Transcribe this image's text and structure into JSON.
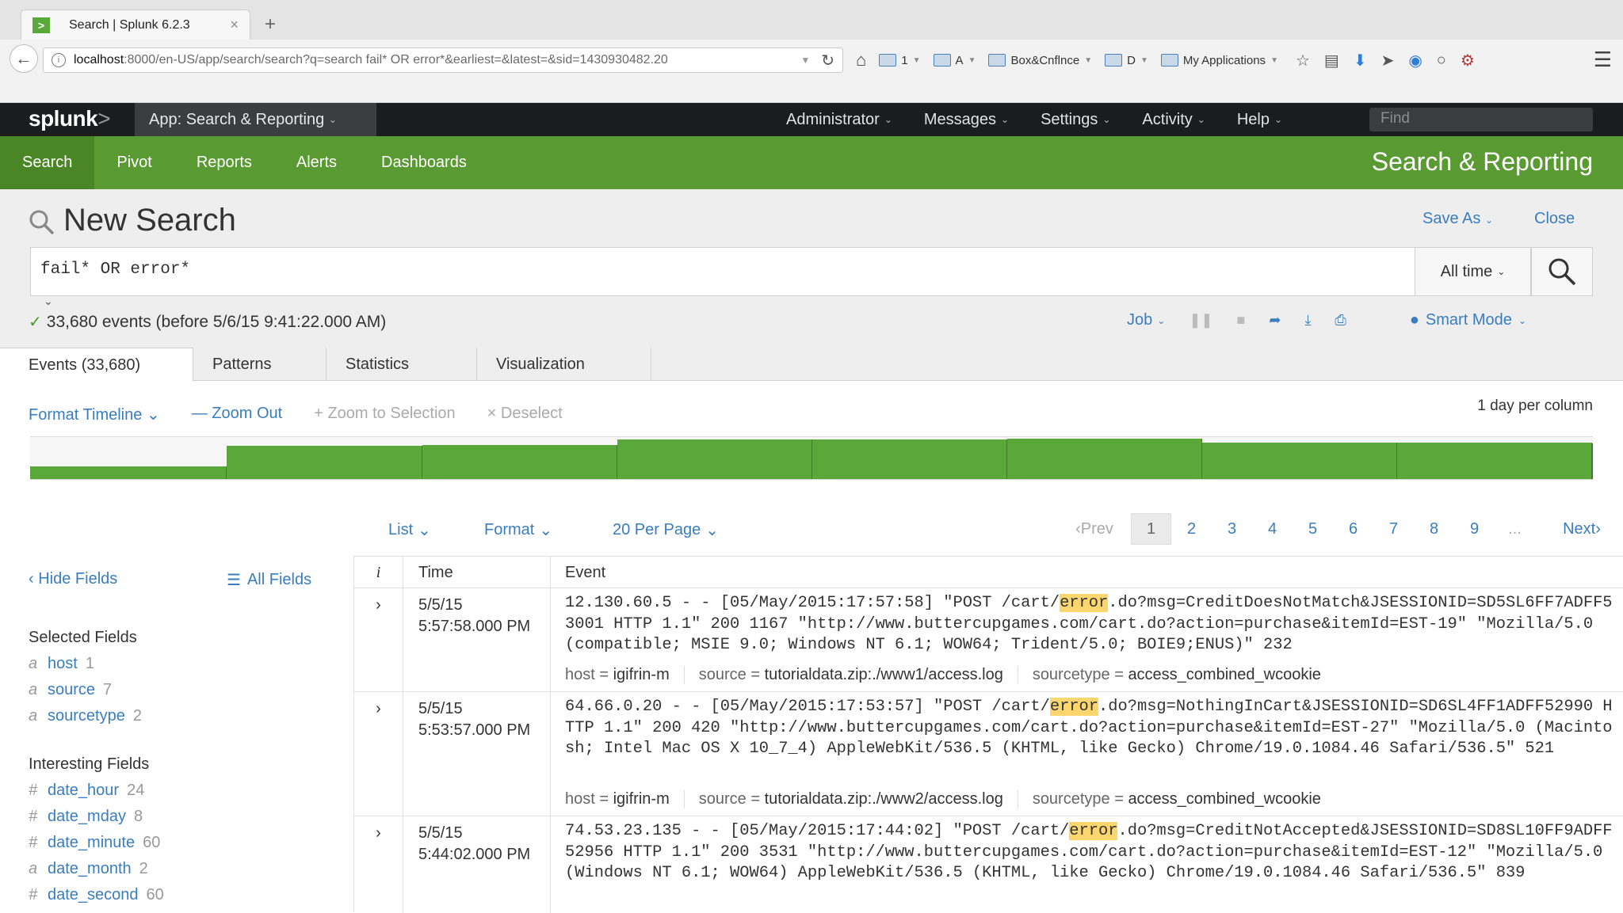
{
  "browser": {
    "tab_title": "Search | Splunk 6.2.3",
    "tab_close": "×",
    "new_tab": "+",
    "url_host": "localhost",
    "url_rest": ":8000/en-US/app/search/search?q=search fail* OR error*&earliest=&latest=&sid=1430930482.20",
    "bookmarks": [
      {
        "label": "1"
      },
      {
        "label": "A"
      },
      {
        "label": "Box&Cnflnce"
      },
      {
        "label": "D"
      },
      {
        "label": "My Applications"
      }
    ]
  },
  "splunk": {
    "logo": "splunk",
    "logo_gt": ">",
    "app_menu": "App: Search & Reporting",
    "top_menu": [
      "Administrator",
      "Messages",
      "Settings",
      "Activity",
      "Help"
    ],
    "find_placeholder": "Find"
  },
  "app_nav": {
    "items": [
      "Search",
      "Pivot",
      "Reports",
      "Alerts",
      "Dashboards"
    ],
    "active": "Search",
    "title": "Search & Reporting"
  },
  "search": {
    "page_title": "New Search",
    "save_as": "Save As",
    "close": "Close",
    "query": "fail* OR error*",
    "time_range": "All time",
    "status": "33,680 events (before 5/6/15 9:41:22.000 AM)",
    "job": "Job",
    "mode": "Smart Mode"
  },
  "result_tabs": [
    "Events (33,680)",
    "Patterns",
    "Statistics",
    "Visualization"
  ],
  "timeline": {
    "format": "Format Timeline",
    "zoom_out": "Zoom Out",
    "zoom_selection": "Zoom to Selection",
    "deselect": "Deselect",
    "scale": "1 day per column",
    "bar_levels": [
      0.32,
      0.82,
      0.85,
      0.98,
      0.98,
      1.0,
      0.9,
      0.9,
      0.88
    ]
  },
  "list_controls": {
    "list": "List",
    "format": "Format",
    "per_page": "20 Per Page",
    "prev": "Prev",
    "pages": [
      "1",
      "2",
      "3",
      "4",
      "5",
      "6",
      "7",
      "8",
      "9"
    ],
    "ellipsis": "...",
    "next": "Next"
  },
  "sidebar": {
    "hide_fields": "Hide Fields",
    "all_fields": "All Fields",
    "selected_title": "Selected Fields",
    "selected": [
      {
        "type": "a",
        "name": "host",
        "count": "1"
      },
      {
        "type": "a",
        "name": "source",
        "count": "7"
      },
      {
        "type": "a",
        "name": "sourcetype",
        "count": "2"
      }
    ],
    "interesting_title": "Interesting Fields",
    "interesting": [
      {
        "type": "#",
        "name": "date_hour",
        "count": "24"
      },
      {
        "type": "#",
        "name": "date_mday",
        "count": "8"
      },
      {
        "type": "#",
        "name": "date_minute",
        "count": "60"
      },
      {
        "type": "a",
        "name": "date_month",
        "count": "2"
      },
      {
        "type": "#",
        "name": "date_second",
        "count": "60"
      }
    ]
  },
  "table": {
    "col_i": "i",
    "col_time": "Time",
    "col_event": "Event",
    "rows": [
      {
        "date": "5/5/15",
        "time": "5:57:58.000 PM",
        "pre": "12.130.60.5 - - [05/May/2015:17:57:58] \"POST /cart/",
        "hl": "error",
        "post": ".do?msg=CreditDoesNotMatch&JSESSIONID=SD5SL6FF7ADFF53001 HTTP 1.1\" 200 1167 \"http://www.buttercupgames.com/cart.do?action=purchase&itemId=EST-19\" \"Mozilla/5.0 (compatible; MSIE 9.0; Windows NT 6.1; WOW64; Trident/5.0; BOIE9;ENUS)\" 232",
        "host": "igifrin-m",
        "source": "tutorialdata.zip:./www1/access.log",
        "sourcetype": "access_combined_wcookie"
      },
      {
        "date": "5/5/15",
        "time": "5:53:57.000 PM",
        "pre": "64.66.0.20 - - [05/May/2015:17:53:57] \"POST /cart/",
        "hl": "error",
        "post": ".do?msg=NothingInCart&JSESSIONID=SD6SL4FF1ADFF52990 HTTP 1.1\" 200 420 \"http://www.buttercupgames.com/cart.do?action=purchase&itemId=EST-27\" \"Mozilla/5.0 (Macintosh; Intel Mac OS X 10_7_4) AppleWebKit/536.5 (KHTML, like Gecko) Chrome/19.0.1084.46 Safari/536.5\" 521",
        "host": "igifrin-m",
        "source": "tutorialdata.zip:./www2/access.log",
        "sourcetype": "access_combined_wcookie"
      },
      {
        "date": "5/5/15",
        "time": "5:44:02.000 PM",
        "pre": "74.53.23.135 - - [05/May/2015:17:44:02] \"POST /cart/",
        "hl": "error",
        "post": ".do?msg=CreditNotAccepted&JSESSIONID=SD8SL10FF9ADFF52956 HTTP 1.1\" 200 3531 \"http://www.buttercupgames.com/cart.do?action=purchase&itemId=EST-12\" \"Mozilla/5.0 (Windows NT 6.1; WOW64) AppleWebKit/536.5 (KHTML, like Gecko) Chrome/19.0.1084.46 Safari/536.5\" 839",
        "host": "",
        "source": "",
        "sourcetype": ""
      }
    ]
  }
}
